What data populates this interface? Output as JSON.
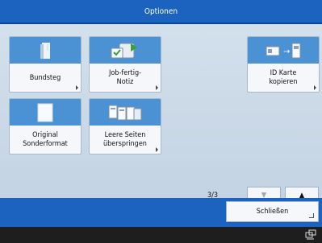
{
  "window": {
    "title": "Optionen"
  },
  "tiles": [
    {
      "label": "Bundsteg",
      "icon": "margin-book-icon"
    },
    {
      "label": "Job-fertig-\nNotiz",
      "icon": "job-notice-icon"
    },
    {
      "label": "ID Karte\nkopieren",
      "icon": "id-card-copy-icon"
    },
    {
      "label": "Original\nSonderformat",
      "icon": "blank-page-icon"
    },
    {
      "label": "Leere Seiten\nüberspringen",
      "icon": "skip-blank-pages-icon"
    }
  ],
  "pager": {
    "indicator": "3/3",
    "up": "▲",
    "down": "▼"
  },
  "footer": {
    "close_label": "Schließen"
  },
  "colors": {
    "accent": "#1c63c0",
    "tile_top": "#4a92d3",
    "panel": "#c6d4e3"
  }
}
